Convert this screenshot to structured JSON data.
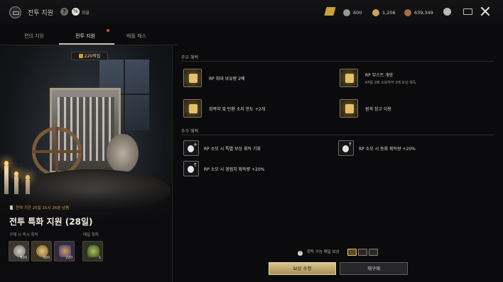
{
  "header": {
    "title": "전투 지원",
    "help_glyph": "?",
    "currency_glyph": "%",
    "currency_label": "화율",
    "resources": [
      {
        "icon": "silver-coin-icon",
        "value": "600",
        "color": "#9a9690"
      },
      {
        "icon": "gold-coin-icon",
        "value": "1,206",
        "color": "#c7a35a"
      },
      {
        "icon": "copper-coin-icon",
        "value": "639,349",
        "color": "#a86a48"
      }
    ]
  },
  "tabs": [
    {
      "label": "편의 지원",
      "active": false
    },
    {
      "label": "전투 지원",
      "active": true,
      "has_notice": true
    },
    {
      "label": "배틀 패스",
      "active": false
    }
  ],
  "hero": {
    "points_badge": "220적립",
    "remaining": "잔여 기간 25일 15시 26분 남음",
    "pack_title": "전투 특화 지원 (28일)",
    "instant_label": "구매 시 즉시 획득",
    "daily_label": "매일 획득",
    "instant_items": [
      {
        "icon": "silver-coin-icon",
        "qty": "600",
        "color": "#8f8c86"
      },
      {
        "icon": "gold-coin-icon",
        "qty": "900",
        "color": "#b48b3e"
      },
      {
        "icon": "medal-icon",
        "qty": "220",
        "color": "#7a5aa0"
      }
    ],
    "daily_items": [
      {
        "icon": "potion-bundle-icon",
        "qty": "1",
        "color": "#6d8a3a"
      }
    ]
  },
  "main_benefits": {
    "title": "주요 혜택",
    "items": [
      {
        "icon": "rp-max-icon",
        "label": "RP 최대 보유량 2배",
        "desc": ""
      },
      {
        "icon": "rp-boost-icon",
        "label": "RP 부스트 개방",
        "desc": "RP를 2배 소모하여 2배 보상 획득"
      },
      {
        "icon": "potion-limit-icon",
        "label": "회복약 및 탄환 소지 한도 +2개",
        "desc": ""
      },
      {
        "icon": "remote-storage-icon",
        "label": "원격 창고 이용",
        "desc": ""
      }
    ]
  },
  "extra_benefits": {
    "title": "추가 혜택",
    "items": [
      {
        "icon": "bonus-reward-icon",
        "label": "RP 소모 시 특별 보상 획득 기회"
      },
      {
        "icon": "gold-bonus-icon",
        "label": "RP 소모 시 동화 획득량 +20%"
      },
      {
        "icon": "exp-bonus-icon",
        "label": "RP 소모 시 경험치 획득량 +20%"
      }
    ]
  },
  "footer": {
    "bonus_note": "획득 가능 매일 보상",
    "claim_button": "보상 수령",
    "rebuy_button": "재구매"
  }
}
